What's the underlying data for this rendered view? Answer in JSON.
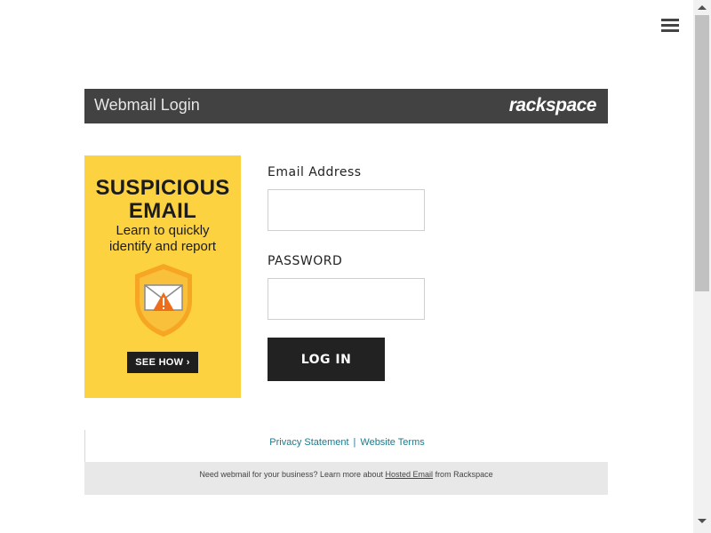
{
  "menu": {
    "icon": "hamburger-menu-icon"
  },
  "header": {
    "title": "Webmail Login",
    "brand": "rackspace",
    "background": "#424242"
  },
  "banner": {
    "title": "SUSPICIOUS\nEMAIL",
    "subtitle": "Learn to quickly\nidentify and report",
    "button_label": "SEE HOW",
    "button_chevron": "›",
    "icon": "shield-email-warning-icon",
    "background": "#fdd240"
  },
  "form": {
    "email_label": "Email Address",
    "email_value": "",
    "password_label": "PASSWORD",
    "password_value": "",
    "login_label": "LOG IN"
  },
  "footer": {
    "privacy_link": "Privacy Statement",
    "separator": "|",
    "terms_link": "Website Terms",
    "promo_prefix": "Need webmail for your business? Learn more about ",
    "promo_link": "Hosted Email",
    "promo_suffix": " from Rackspace",
    "link_color": "#1a7a8c"
  }
}
